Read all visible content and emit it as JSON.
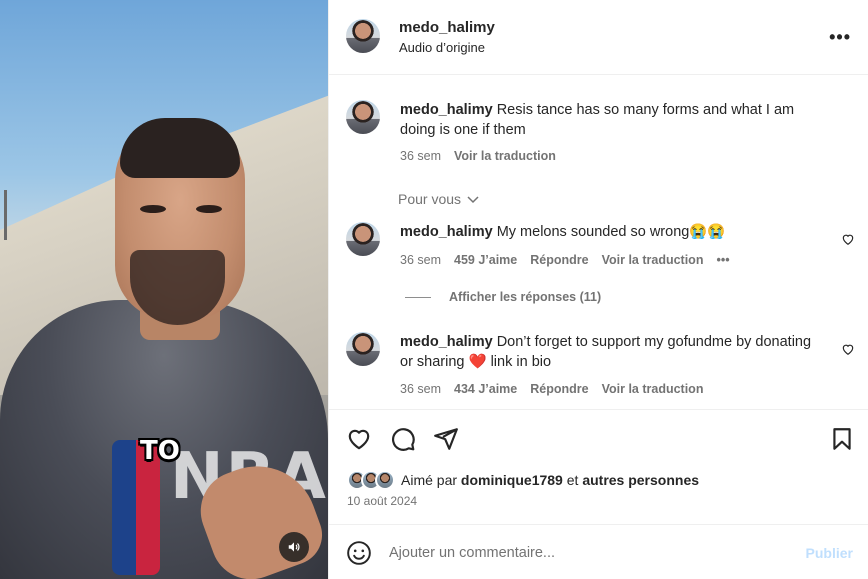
{
  "video": {
    "caption": "TO",
    "shirt_letters": "NBA",
    "mute_icon": "speaker-icon"
  },
  "header": {
    "username": "medo_halimy",
    "subtitle": "Audio d’origine",
    "more_icon": "•••"
  },
  "comments": [
    {
      "username": "medo_halimy",
      "text": "Resis tance has so many forms and what I am doing is one if them",
      "time": "36 sem",
      "translate": "Voir la traduction"
    },
    {
      "username": "medo_halimy",
      "text": "My melons sounded so wrong😭😭",
      "time": "36 sem",
      "likes": "459 J’aime",
      "reply": "Répondre",
      "translate": "Voir la traduction",
      "more": "•••"
    },
    {
      "username": "medo_halimy",
      "text": "Don’t forget to support my gofundme by donating or sharing ❤️ link in bio",
      "time": "36 sem",
      "likes": "434 J’aime",
      "reply": "Répondre",
      "translate": "Voir la traduction"
    }
  ],
  "for_you": "Pour vous",
  "show_replies": "Afficher les réponses (11)",
  "likes_summary": {
    "prefix": "Aimé par",
    "user": "dominique1789",
    "mid": "et",
    "others": "autres personnes"
  },
  "post_date": "10 août 2024",
  "composer": {
    "placeholder": "Ajouter un commentaire...",
    "publish": "Publier"
  },
  "colors": {
    "text": "#262626",
    "secondary": "#737373",
    "publish_disabled": "#c0dffd",
    "divider": "#efefef"
  }
}
